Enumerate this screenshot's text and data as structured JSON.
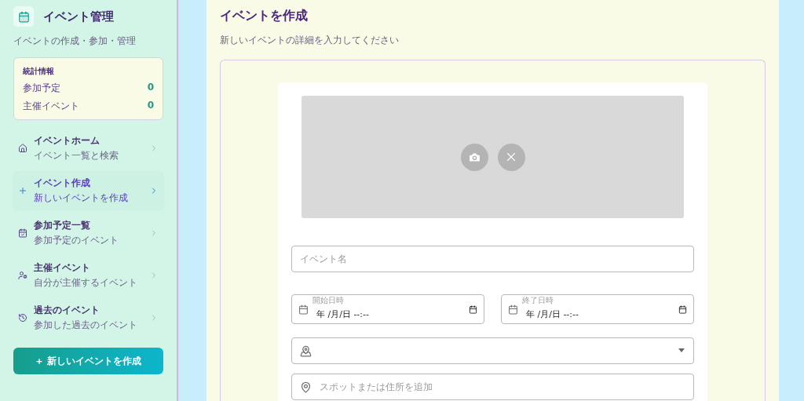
{
  "sidebar": {
    "title": "イベント管理",
    "subtitle": "イベントの作成・参加・管理",
    "stats": {
      "title": "統計情報",
      "rows": [
        {
          "label": "参加予定",
          "value": "0"
        },
        {
          "label": "主催イベント",
          "value": "0"
        }
      ]
    },
    "nav": [
      {
        "label": "イベントホーム",
        "sub": "イベント一覧と検索",
        "selected": false
      },
      {
        "label": "イベント作成",
        "sub": "新しいイベントを作成",
        "selected": true
      },
      {
        "label": "参加予定一覧",
        "sub": "参加予定のイベント",
        "selected": false
      },
      {
        "label": "主催イベント",
        "sub": "自分が主催するイベント",
        "selected": false
      },
      {
        "label": "過去のイベント",
        "sub": "参加した過去のイベント",
        "selected": false
      }
    ],
    "create_button": "＋ 新しいイベントを作成"
  },
  "main": {
    "title": "イベントを作成",
    "subtitle": "新しいイベントの詳細を入力してください",
    "form": {
      "image": {
        "kind": "empty"
      },
      "name_placeholder": "イベント名",
      "dates": [
        {
          "label": "開始日時",
          "value": "年 /月/日 --:--"
        },
        {
          "label": "終了日時",
          "value": "年 /月/日 --:--"
        }
      ],
      "spot_placeholder": "スポットまたは住所を追加"
    }
  }
}
